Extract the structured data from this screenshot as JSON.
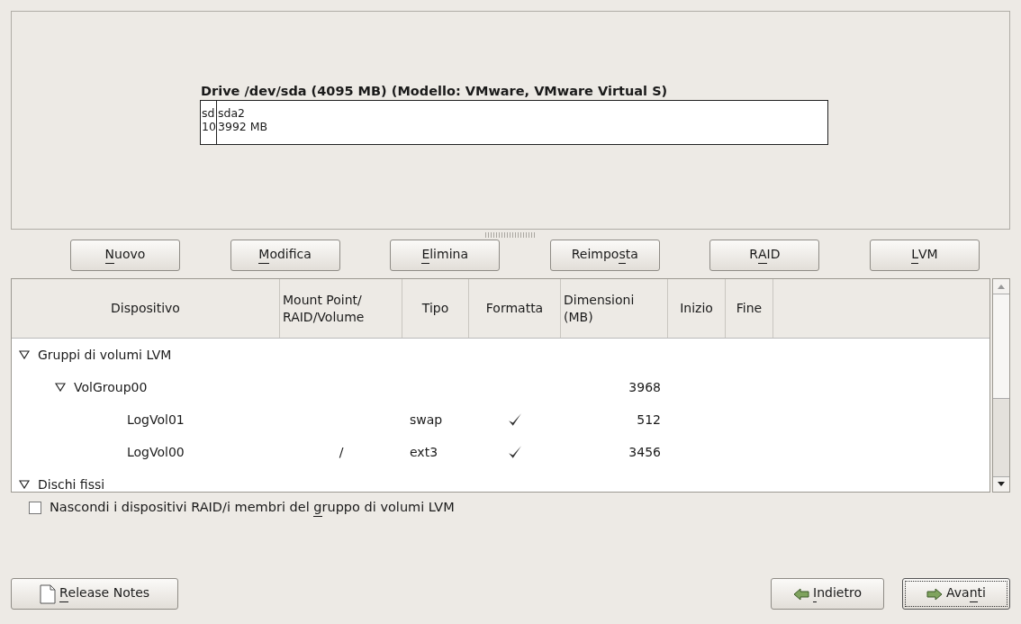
{
  "drive": {
    "title": "Drive /dev/sda (4095 MB) (Modello: VMware, VMware Virtual S)",
    "partitions": [
      {
        "name": "sd",
        "size": "10"
      },
      {
        "name": "sda2",
        "size": "3992 MB"
      }
    ]
  },
  "actions": [
    {
      "label": [
        {
          "text": "N",
          "mnemonic": true
        },
        {
          "text": "uovo",
          "mnemonic": false
        }
      ]
    },
    {
      "label": [
        {
          "text": "M",
          "mnemonic": true
        },
        {
          "text": "odifica",
          "mnemonic": false
        }
      ]
    },
    {
      "label": [
        {
          "text": "E",
          "mnemonic": true
        },
        {
          "text": "limina",
          "mnemonic": false
        }
      ]
    },
    {
      "label": [
        {
          "text": "Reimpo",
          "mnemonic": false
        },
        {
          "text": "s",
          "mnemonic": true
        },
        {
          "text": "ta",
          "mnemonic": false
        }
      ]
    },
    {
      "label": [
        {
          "text": "R",
          "mnemonic": false
        },
        {
          "text": "A",
          "mnemonic": true
        },
        {
          "text": "ID",
          "mnemonic": false
        }
      ]
    },
    {
      "label": [
        {
          "text": "L",
          "mnemonic": true
        },
        {
          "text": "VM",
          "mnemonic": false
        }
      ]
    }
  ],
  "table": {
    "columns": [
      "Dispositivo",
      "Mount Point/ RAID/Volume",
      "Tipo",
      "Formatta",
      "Dimensioni (MB)",
      "Inizio",
      "Fine"
    ],
    "rows": [
      {
        "device": "Gruppi di volumi LVM",
        "expanded": true,
        "children": [
          {
            "device": "VolGroup00",
            "expanded": true,
            "size": "3968",
            "children": [
              {
                "device": "LogVol01",
                "type": "swap",
                "format": true,
                "size": "512"
              },
              {
                "device": "LogVol00",
                "mount": "/",
                "type": "ext3",
                "format": true,
                "size": "3456"
              }
            ]
          }
        ]
      },
      {
        "device": "Dischi fissi",
        "expanded": true
      }
    ]
  },
  "hide_option": {
    "label": [
      {
        "text": "Nascondi i dispositivi RAID/i membri del ",
        "mnemonic": false
      },
      {
        "text": "g",
        "mnemonic": true
      },
      {
        "text": "ruppo di volumi LVM",
        "mnemonic": false
      }
    ],
    "checked": false
  },
  "footer": {
    "release_notes": {
      "label": [
        {
          "text": "R",
          "mnemonic": true
        },
        {
          "text": "elease Notes",
          "mnemonic": false
        }
      ]
    },
    "back": {
      "label": [
        {
          "text": "I",
          "mnemonic": true
        },
        {
          "text": "ndietro",
          "mnemonic": false
        }
      ]
    },
    "next": {
      "label": [
        {
          "text": "Ava",
          "mnemonic": false
        },
        {
          "text": "n",
          "mnemonic": true
        },
        {
          "text": "ti",
          "mnemonic": false
        }
      ],
      "focused": true
    }
  }
}
